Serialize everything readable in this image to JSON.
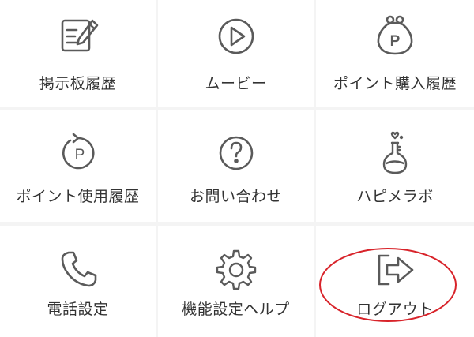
{
  "menu": {
    "items": [
      {
        "label": "掲示板履歴",
        "icon": "bulletin-board-icon"
      },
      {
        "label": "ムービー",
        "icon": "play-icon"
      },
      {
        "label": "ポイント購入履歴",
        "icon": "coin-purse-icon"
      },
      {
        "label": "ポイント使用履歴",
        "icon": "point-history-icon"
      },
      {
        "label": "お問い合わせ",
        "icon": "question-icon"
      },
      {
        "label": "ハピメラボ",
        "icon": "flask-heart-icon"
      },
      {
        "label": "電話設定",
        "icon": "phone-icon"
      },
      {
        "label": "機能設定ヘルプ",
        "icon": "gear-icon"
      },
      {
        "label": "ログアウト",
        "icon": "logout-icon"
      }
    ]
  },
  "colors": {
    "icon_stroke": "#5a5a5a",
    "label_text": "#333333",
    "tile_background": "#ffffff",
    "grid_background": "#f4f4f4",
    "annotation": "#d8232a"
  }
}
